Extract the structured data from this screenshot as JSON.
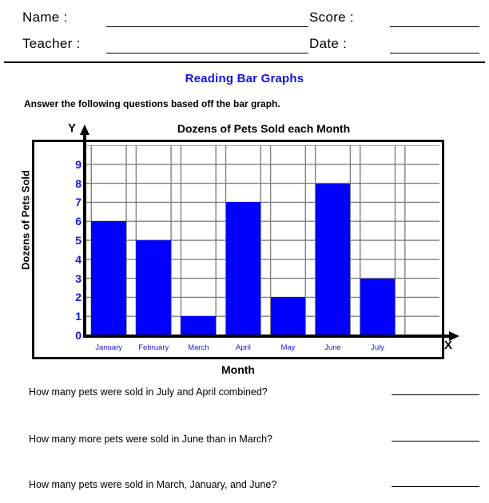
{
  "header": {
    "name_label": "Name :",
    "teacher_label": "Teacher :",
    "score_label": "Score :",
    "date_label": "Date :",
    "name_value": "",
    "teacher_value": "",
    "score_value": "",
    "date_value": ""
  },
  "worksheet": {
    "title": "Reading Bar Graphs",
    "title_color": "#1414e0",
    "instruction": "Answer the following questions based off the bar graph."
  },
  "chart_data": {
    "type": "bar",
    "title": "Dozens of Pets Sold each Month",
    "xlabel": "Month",
    "ylabel": "Dozens of Pets Sold",
    "x_axis_letter": "X",
    "y_axis_letter": "Y",
    "categories": [
      "January",
      "February",
      "March",
      "April",
      "May",
      "June",
      "July"
    ],
    "values": [
      6,
      5,
      1,
      7,
      2,
      8,
      3
    ],
    "ylim": [
      0,
      10
    ],
    "ytick_labels": [
      "0",
      "1",
      "2",
      "3",
      "4",
      "5",
      "6",
      "7",
      "8",
      "9"
    ],
    "grid": true,
    "legend": "none",
    "bar_color": "#0000ff",
    "tick_label_color": "#1414e0",
    "grid_color": "#808080",
    "axis_color": "#000000"
  },
  "questions": [
    {
      "text": "How many pets were sold in July and April combined?",
      "answer": ""
    },
    {
      "text": "How many more pets were sold in June than in March?",
      "answer": ""
    },
    {
      "text": "How many pets were sold in March, January, and June?",
      "answer": ""
    }
  ]
}
